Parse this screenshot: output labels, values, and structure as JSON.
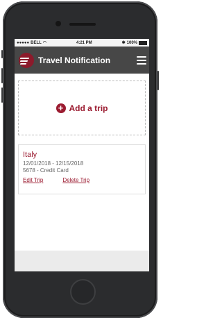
{
  "status_bar": {
    "carrier": "BELL",
    "time": "4:21 PM",
    "battery": "100%"
  },
  "app_bar": {
    "title": "Travel Notification"
  },
  "add_trip": {
    "label": "Add a trip"
  },
  "trips": [
    {
      "name": "Italy",
      "dates": "12/01/2018 - 12/15/2018",
      "card": "5678 - Credit Card",
      "edit_label": "Edit Trip",
      "delete_label": "Delete Trip"
    }
  ],
  "colors": {
    "brand": "#9b1b30",
    "app_bar": "#474747",
    "screen_background": "#ebebeb"
  }
}
